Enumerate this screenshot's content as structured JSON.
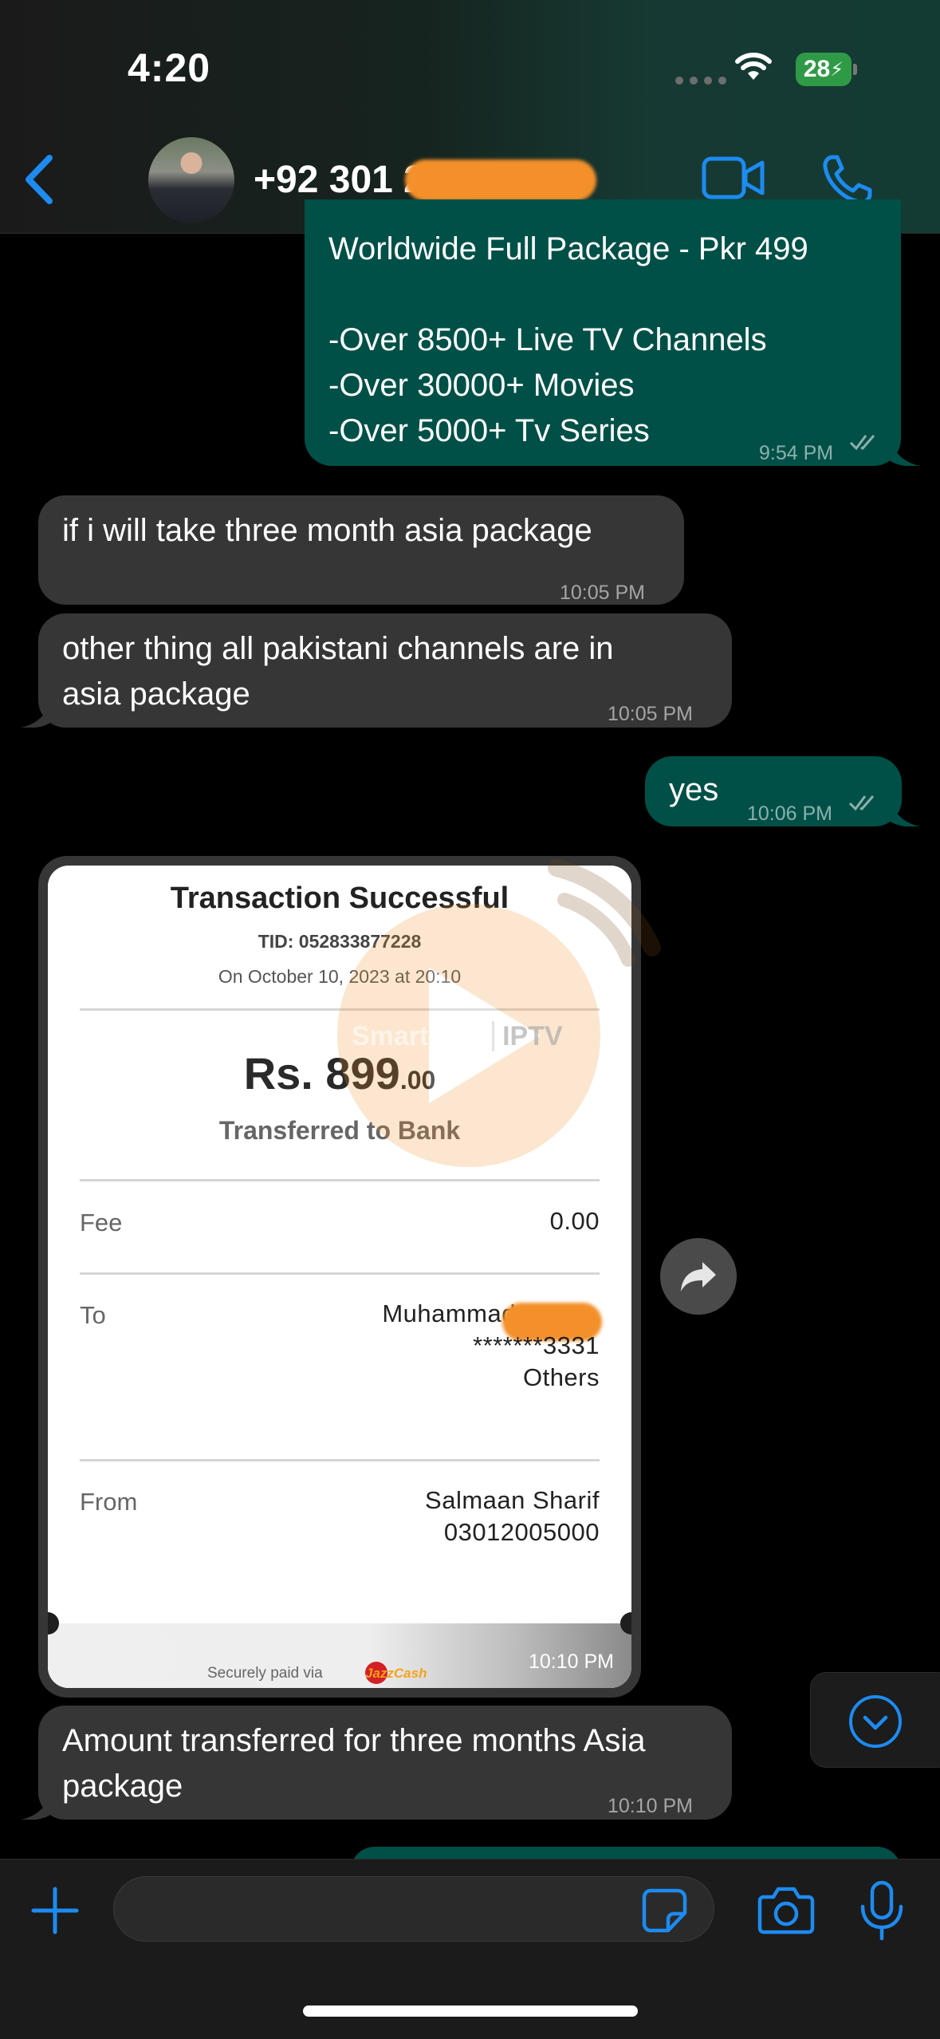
{
  "status_bar": {
    "time": "4:20",
    "battery": "28"
  },
  "header": {
    "contact_number": "+92 301 2"
  },
  "messages": [
    {
      "direction": "out",
      "lines": "Worldwide Full Package - Pkr 499\n\n-Over 8500+ Live TV Channels\n-Over 30000+ Movies\n-Over 5000+ Tv Series",
      "time": "9:54 PM"
    },
    {
      "direction": "in",
      "lines": "if i will take three month asia package",
      "time": "10:05 PM"
    },
    {
      "direction": "in",
      "lines": "other thing all pakistani channels are in\nasia package",
      "time": "10:05 PM"
    },
    {
      "direction": "out",
      "lines": "yes",
      "time": "10:06 PM"
    },
    {
      "direction": "in",
      "lines": "Amount transferred for three months Asia\npackage",
      "time": "10:10 PM"
    }
  ],
  "receipt": {
    "title": "Transaction Successful",
    "tid": "TID: 052833877228",
    "date": "On October 10, 2023 at 20:10",
    "amount_main": "Rs. 899",
    "amount_cents": ".00",
    "transfer_type": "Transferred to Bank",
    "fee_label": "Fee",
    "fee_value": "0.00",
    "to_label": "To",
    "to_name": "Muhammad",
    "to_account": "*******3331",
    "to_bank": "Others",
    "from_label": "From",
    "from_name": "Salmaan Sharif",
    "from_number": "03012005000",
    "secure_text": "Securely paid via",
    "brand": "JazzCash",
    "time": "10:10 PM"
  },
  "watermark": {
    "name": "SmartCast",
    "suffix": "IPTV"
  },
  "colors": {
    "accent": "#0a84ff",
    "outgoing": "#005047",
    "incoming": "#363636",
    "redaction": "#f4902a"
  }
}
